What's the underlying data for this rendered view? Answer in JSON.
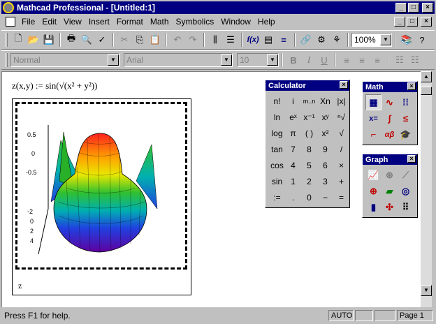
{
  "window": {
    "title": "Mathcad Professional - [Untitled:1]",
    "min_symbol": "_",
    "max_symbol": "□",
    "close_symbol": "×"
  },
  "menu": [
    "File",
    "Edit",
    "View",
    "Insert",
    "Format",
    "Math",
    "Symbolics",
    "Window",
    "Help"
  ],
  "toolbar": {
    "zoom": "100%",
    "fx_label": "f(x)"
  },
  "format_bar": {
    "style": "Normal",
    "font": "Arial",
    "size": "10",
    "bold": "B",
    "italic": "I",
    "underline": "U"
  },
  "document": {
    "formula": "z(x,y) := sin(√(x² + y²))",
    "plot_caption": "z",
    "z_ticks": [
      "0.5",
      "0",
      "-0.5"
    ],
    "axis_ticks": [
      "-2",
      "0",
      "2",
      "4"
    ]
  },
  "calculator": {
    "title": "Calculator",
    "keys": [
      "n!",
      "i",
      "m..n",
      "Xn",
      "|x|",
      "ln",
      "eˣ",
      "x⁻¹",
      "xʸ",
      "ⁿ√",
      "log",
      "π",
      "( )",
      "x²",
      "√",
      "tan",
      "7",
      "8",
      "9",
      "/",
      "cos",
      "4",
      "5",
      "6",
      "×",
      "sin",
      "1",
      "2",
      "3",
      "+",
      ":=",
      ".",
      "0",
      "−",
      "="
    ]
  },
  "math_palette": {
    "title": "Math",
    "icons": [
      "calculator-icon",
      "graph-toolbar-icon",
      "matrix-icon",
      "evaluation-icon",
      "calculus-icon",
      "boolean-icon",
      "programming-icon",
      "greek-icon",
      "symbolic-icon"
    ]
  },
  "graph_palette": {
    "title": "Graph",
    "icons": [
      "xy-plot-icon",
      "polar-plot-icon",
      "surface-plot-icon",
      "contour-plot-icon",
      "3d-scatter-icon",
      "3d-bar-icon",
      "vector-field-icon",
      "trace-icon",
      "zoom-icon"
    ]
  },
  "status": {
    "help": "Press F1 for help.",
    "mode": "AUTO",
    "page": "Page 1"
  },
  "colors": {
    "title_bar": "#000080",
    "face": "#c0c0c0"
  }
}
